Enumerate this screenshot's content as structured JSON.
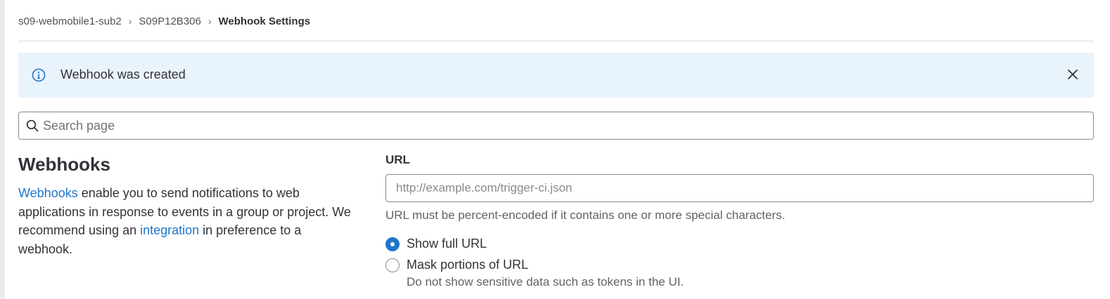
{
  "breadcrumb": {
    "items": [
      "s09-webmobile1-sub2",
      "S09P12B306"
    ],
    "current": "Webhook Settings"
  },
  "alert": {
    "message": "Webhook was created",
    "icon": "info-icon",
    "close_icon": "close-icon",
    "background": "#e9f3fc"
  },
  "search": {
    "placeholder": "Search page",
    "value": ""
  },
  "section": {
    "title": "Webhooks",
    "desc_link1": "Webhooks",
    "desc_part1": " enable you to send notifications to web applications in response to events in a group or project. We recommend using an ",
    "desc_link2": "integration",
    "desc_part2": " in preference to a webhook."
  },
  "form": {
    "url_label": "URL",
    "url_placeholder": "http://example.com/trigger-ci.json",
    "url_value": "",
    "url_help": "URL must be percent-encoded if it contains one or more special characters.",
    "radio_options": [
      {
        "label": "Show full URL",
        "checked": true
      },
      {
        "label": "Mask portions of URL",
        "checked": false
      }
    ],
    "mask_help": "Do not show sensitive data such as tokens in the UI."
  },
  "colors": {
    "accent": "#1f75cb",
    "alert_bg": "#e9f3fc",
    "text": "#333238"
  }
}
